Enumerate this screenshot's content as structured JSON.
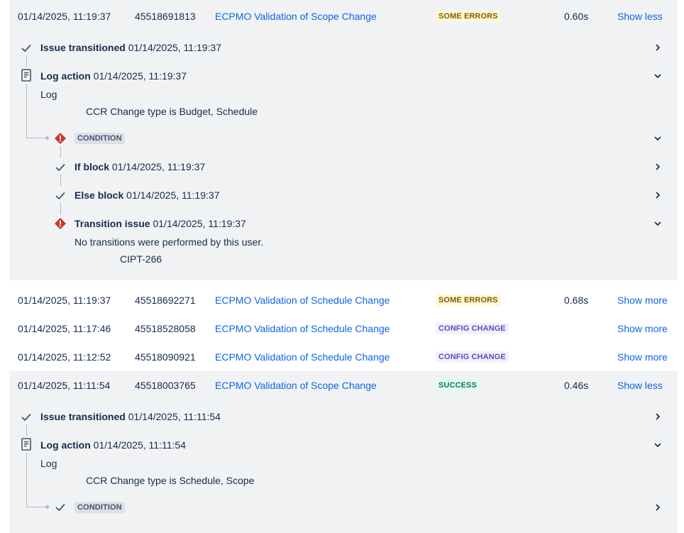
{
  "rows": [
    {
      "time": "01/14/2025, 11:19:37",
      "id": "45518691813",
      "rule": "ECPMO Validation of Scope Change",
      "status": "SOME ERRORS",
      "duration": "0.60s",
      "toggle": "Show less"
    },
    {
      "time": "01/14/2025, 11:19:37",
      "id": "45518692271",
      "rule": "ECPMO Validation of Schedule Change",
      "status": "SOME ERRORS",
      "duration": "0.68s",
      "toggle": "Show more"
    },
    {
      "time": "01/14/2025, 11:17:46",
      "id": "45518528058",
      "rule": "ECPMO Validation of Schedule Change",
      "status": "CONFIG CHANGE",
      "duration": "",
      "toggle": "Show more"
    },
    {
      "time": "01/14/2025, 11:12:52",
      "id": "45518090921",
      "rule": "ECPMO Validation of Schedule Change",
      "status": "CONFIG CHANGE",
      "duration": "",
      "toggle": "Show more"
    },
    {
      "time": "01/14/2025, 11:11:54",
      "id": "45518003765",
      "rule": "ECPMO Validation of Scope Change",
      "status": "SUCCESS",
      "duration": "0.46s",
      "toggle": "Show less"
    }
  ],
  "detail1": {
    "issue_transitioned": {
      "label": "Issue transitioned",
      "time": "01/14/2025, 11:19:37"
    },
    "log_action": {
      "label": "Log action",
      "time": "01/14/2025, 11:19:37",
      "log_label": "Log",
      "message": "CCR Change type is Budget, Schedule"
    },
    "condition": {
      "label": "CONDITION"
    },
    "if_block": {
      "label": "If block",
      "time": "01/14/2025, 11:19:37"
    },
    "else_block": {
      "label": "Else block",
      "time": "01/14/2025, 11:19:37"
    },
    "transition_issue": {
      "label": "Transition issue",
      "time": "01/14/2025, 11:19:37",
      "message": "No transitions were performed by this user.",
      "issue_key": "CIPT-266"
    }
  },
  "detail2": {
    "issue_transitioned": {
      "label": "Issue transitioned",
      "time": "01/14/2025, 11:11:54"
    },
    "log_action": {
      "label": "Log action",
      "time": "01/14/2025, 11:11:54",
      "log_label": "Log",
      "message": "CCR Change type is Schedule, Scope"
    },
    "condition": {
      "label": "CONDITION"
    }
  },
  "colors": {
    "link": "#0c66e4",
    "panel_bg": "#f1f2f4",
    "error": "#c9372c",
    "success_check": "#44546f"
  },
  "icons": {
    "check": "check-icon",
    "error": "error-diamond-icon",
    "document": "document-icon",
    "chevron_right": "chevron-right-icon",
    "chevron_down": "chevron-down-icon"
  }
}
